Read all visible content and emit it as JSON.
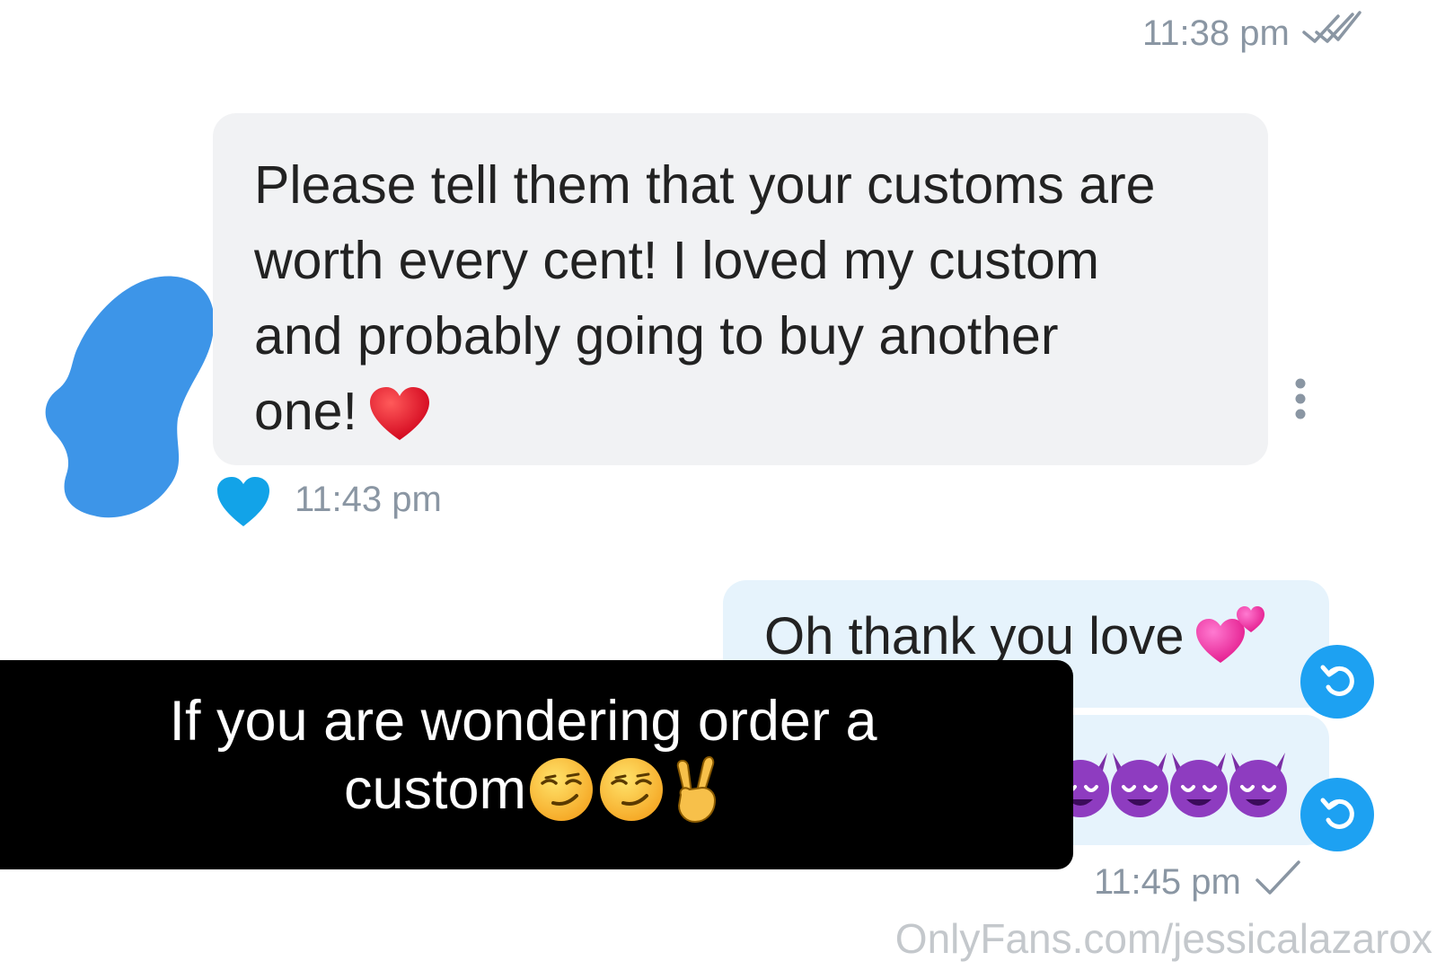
{
  "messages": {
    "outgoing_prev_time": "11:38 pm",
    "incoming": {
      "text_lines": [
        "Please tell them that your customs are",
        "worth every cent! I loved my custom",
        "and probably going to buy another",
        "one!"
      ],
      "time": "11:43 pm"
    },
    "reply": {
      "text": "Oh thank you love",
      "time": "11:45 pm"
    }
  },
  "overlay": {
    "line1": "If you are wondering order a",
    "line2": "custom"
  },
  "watermark": "OnlyFans.com/jessicalazarox",
  "icons": {
    "double_tick": "double-check-icon",
    "single_tick": "check-icon",
    "like": "heart-icon",
    "more": "more-vertical-icon",
    "undo": "undo-icon"
  },
  "colors": {
    "accent": "#1da1f2",
    "like": "#12a3e8",
    "incoming_bubble": "#f1f2f4",
    "outgoing_bubble": "#e6f3fc",
    "timestamp": "#8a96a3",
    "avatar_redaction": "#3d95e8",
    "overlay_bg": "#000000"
  }
}
